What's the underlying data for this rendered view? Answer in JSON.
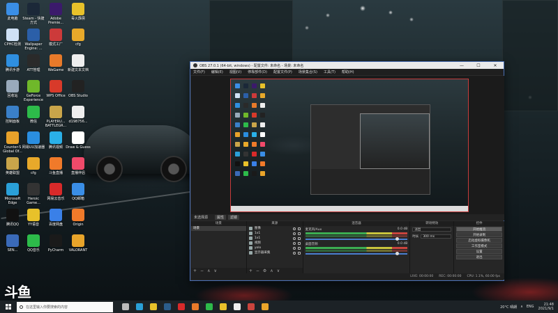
{
  "desktop": {
    "icons": [
      {
        "label": "此电脑",
        "color": "#3a8ee6"
      },
      {
        "label": "Steam - 快捷方式",
        "color": "#1b2838"
      },
      {
        "label": "Adobe Premie...",
        "color": "#3b1a6b"
      },
      {
        "label": "毒火霹雳",
        "color": "#e8c12a"
      },
      {
        "label": "CPHC检测",
        "color": "#cfe1f5"
      },
      {
        "label": "Wallpaper Engine: ...",
        "color": "#2b5fa8"
      },
      {
        "label": "模式工厂",
        "color": "#cc3a3a"
      },
      {
        "label": "cfg",
        "color": "#e8a92a"
      },
      {
        "label": "腾讯手游",
        "color": "#2f8fe0"
      },
      {
        "label": "ATT管理",
        "color": "#2a2a2a"
      },
      {
        "label": "WeGame",
        "color": "#e87a2a"
      },
      {
        "label": "新建文本文档",
        "color": "#eeeeee"
      },
      {
        "label": "回收站",
        "color": "#9ab"
      },
      {
        "label": "GeForce Experience",
        "color": "#6fb82a"
      },
      {
        "label": "WPS Office",
        "color": "#d83a2a"
      },
      {
        "label": "OBS Studio",
        "color": "#222222"
      },
      {
        "label": "控制面板",
        "color": "#3a80c8"
      },
      {
        "label": "微信",
        "color": "#2dbb4a"
      },
      {
        "label": "PLAYERU... BATTLEGR...",
        "color": "#c9a54a"
      },
      {
        "label": "d198756...",
        "color": "#eeeeee"
      },
      {
        "label": "Counter-S Global Of...",
        "color": "#e8a22a"
      },
      {
        "label": "网易UU加速器",
        "color": "#2a8ee0"
      },
      {
        "label": "腾讯视频",
        "color": "#2ab0e8"
      },
      {
        "label": "Draw & Guess",
        "color": "#ffffff"
      },
      {
        "label": "英雄联盟",
        "color": "#c9a54a"
      },
      {
        "label": "cfg",
        "color": "#e8a92a"
      },
      {
        "label": "斗鱼直播",
        "color": "#f07a2a"
      },
      {
        "label": "直播伴侣",
        "color": "#f04a6a"
      },
      {
        "label": "Microsoft Edge",
        "color": "#2aa0d8"
      },
      {
        "label": "Heroic Game...",
        "color": "#333333"
      },
      {
        "label": "网易云音乐",
        "color": "#d82a2a"
      },
      {
        "label": "QQ邮箱",
        "color": "#3a8ee6"
      },
      {
        "label": "腾讯QQ",
        "color": "#111111"
      },
      {
        "label": "YY语音",
        "color": "#e8c12a"
      },
      {
        "label": "百度网盘",
        "color": "#3a80e8"
      },
      {
        "label": "Origin",
        "color": "#f07a2a"
      },
      {
        "label": "SEN...",
        "color": "#3a6ab8"
      },
      {
        "label": "QQ音乐",
        "color": "#2dbb4a"
      },
      {
        "label": "PyCharm",
        "color": "#1a1a1a"
      },
      {
        "label": "VALORANT",
        "color": "#e8a42a"
      }
    ],
    "watermark": "斗鱼"
  },
  "obs": {
    "title": "OBS 27.0.1 (64-bit, windows) - 配置文件: 未命名 - 场景: 未命名",
    "controls": [
      "—",
      "☐",
      "✕"
    ],
    "menu": [
      "文件(F)",
      "编辑(E)",
      "视图(V)",
      "停靠部件(D)",
      "配置文件(P)",
      "场景集合(S)",
      "工具(T)",
      "帮助(H)"
    ],
    "scene_bar": {
      "label": "未选择源",
      "props": "属性",
      "filters": "滤镜"
    },
    "docks": {
      "scenes": {
        "title": "场景",
        "items": [
          "场景"
        ]
      },
      "sources": {
        "title": "来源",
        "items": [
          "图像",
          "1x1",
          "1x1",
          "视频",
          "yolo",
          "显示器采集"
        ]
      },
      "mixer": {
        "title": "混音器",
        "channels": [
          {
            "name": "麦克风/Aux",
            "level": "0.0 dB"
          },
          {
            "name": "桌面音频",
            "level": "0.0 dB"
          }
        ]
      },
      "transitions": {
        "title": "转场特效",
        "type": "淡出",
        "duration_label": "时长",
        "duration": "300 ms"
      },
      "controls": {
        "title": "控件",
        "buttons": [
          "开始推流",
          "开始录制",
          "启动虚拟摄像机",
          "工作室模式",
          "设置",
          "退出"
        ]
      }
    },
    "status": [
      "LIVE: 00:00:00",
      "REC: 00:00:00",
      "CPU: 1.1%, 60.00 fps"
    ]
  },
  "taskbar": {
    "search_placeholder": "在这里输入你要搜索的内容",
    "apps": [
      {
        "name": "task-view",
        "color": "#bbbbbb"
      },
      {
        "name": "edge",
        "color": "#2aa0d8"
      },
      {
        "name": "explorer",
        "color": "#e8c12a"
      },
      {
        "name": "steam",
        "color": "#2b5c8a"
      },
      {
        "name": "netease",
        "color": "#d82a2a"
      },
      {
        "name": "wegame",
        "color": "#e87a2a"
      },
      {
        "name": "wechat",
        "color": "#2dbb4a"
      },
      {
        "name": "chrome",
        "color": "#e8c12a"
      },
      {
        "name": "obs",
        "color": "#eeeeee"
      },
      {
        "name": "app",
        "color": "#c9443d"
      },
      {
        "name": "other",
        "color": "#e8a42a"
      }
    ],
    "weather": "20°C 晴朗",
    "lang": "ENG",
    "time": "21:48",
    "date": "2021/9/1"
  }
}
